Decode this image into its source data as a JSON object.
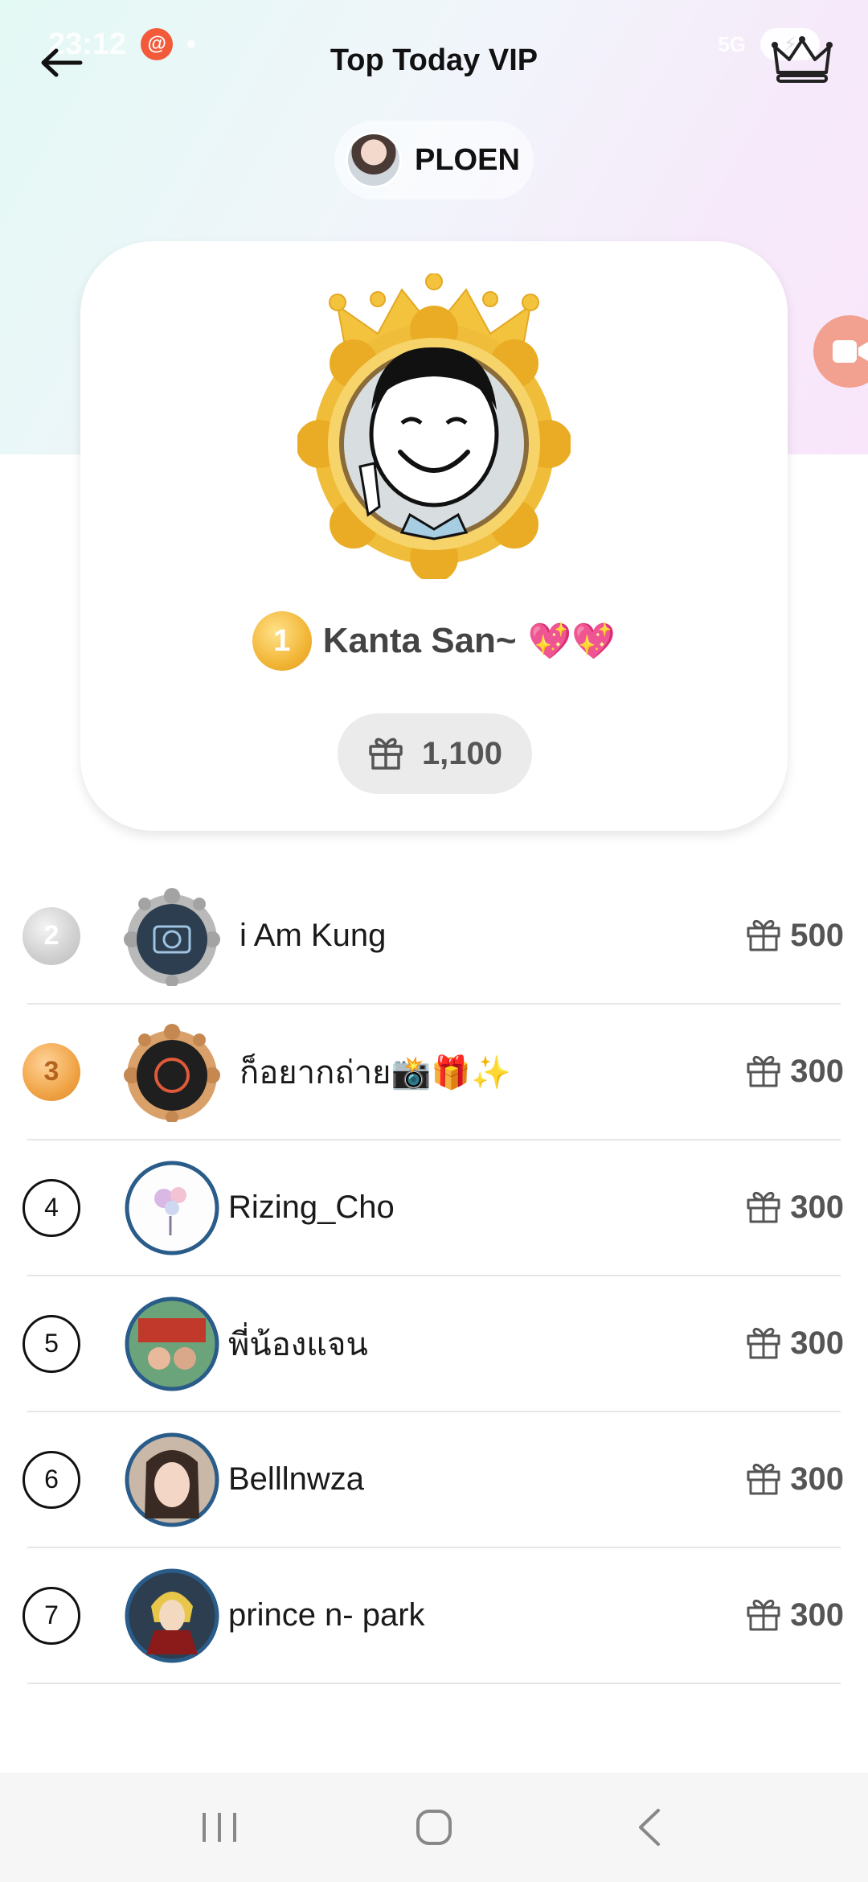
{
  "status_bar": {
    "time": "23:12",
    "network": "5G"
  },
  "header": {
    "title": "Top Today VIP"
  },
  "host": {
    "name": "PLOEN"
  },
  "top_fan": {
    "rank": "1",
    "name": "Kanta San~",
    "emoji": "💖💖",
    "gift_total": "1,100"
  },
  "leaderboard": [
    {
      "rank": "2",
      "name": "i Am Kung",
      "gifts": "500",
      "tier": "silver"
    },
    {
      "rank": "3",
      "name": "ก็อยากถ่าย📸🎁✨",
      "gifts": "300",
      "tier": "bronze"
    },
    {
      "rank": "4",
      "name": "Rizing_Cho",
      "gifts": "300",
      "tier": "plain"
    },
    {
      "rank": "5",
      "name": "พี่น้องแจน",
      "gifts": "300",
      "tier": "plain"
    },
    {
      "rank": "6",
      "name": "Belllnwza",
      "gifts": "300",
      "tier": "plain"
    },
    {
      "rank": "7",
      "name": "prince n- park",
      "gifts": "300",
      "tier": "plain"
    }
  ],
  "icons": {
    "back": "back-arrow-icon",
    "crown": "crown-icon",
    "gift": "gift-icon",
    "video": "video-camera-icon",
    "nav_recents": "recents-icon",
    "nav_home": "home-icon",
    "nav_back": "nav-back-icon"
  },
  "colors": {
    "gold": "#f2b637",
    "silver": "#c9c9c9",
    "bronze": "#e8953a",
    "ring": "#2a5c8a",
    "fab": "#f2a08f"
  }
}
